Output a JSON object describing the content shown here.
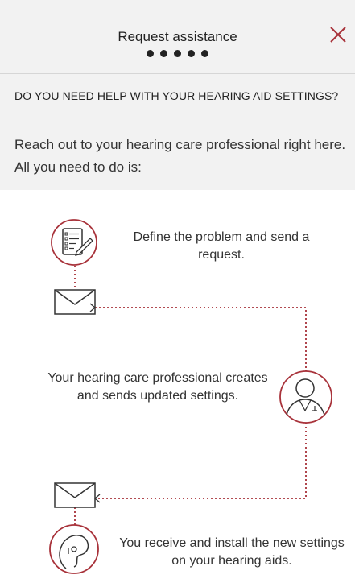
{
  "header": {
    "title": "Request assistance",
    "close_icon": "close-icon",
    "progress_dots": 5
  },
  "content": {
    "heading": "DO YOU NEED HELP WITH YOUR HEARING AID SETTINGS?",
    "intro": "Reach out to your hearing care professional right here. All you need to do is:"
  },
  "steps": [
    {
      "icon": "document-pen-icon",
      "text": "Define the problem and send a request."
    },
    {
      "icon": "professional-avatar-icon",
      "text": "Your hearing care professional creates and sends updated settings."
    },
    {
      "icon": "hearing-aid-icon",
      "text": "You receive and install the new settings on your hearing aids."
    }
  ],
  "colors": {
    "accent": "#a8323a",
    "background": "#f2f2f2",
    "panel": "#ffffff",
    "text": "#222222"
  }
}
